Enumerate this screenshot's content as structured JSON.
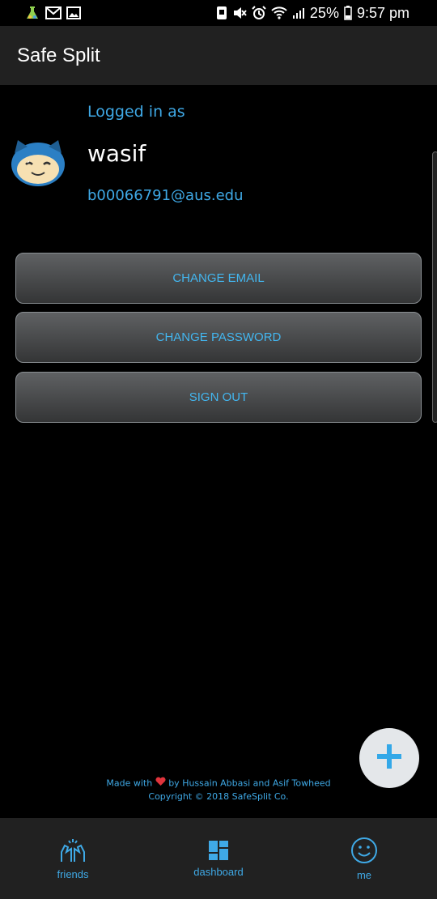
{
  "status_bar": {
    "battery": "25%",
    "time": "9:57 pm",
    "icons_left": [
      "app-notification-icon",
      "gmail-icon",
      "gallery-icon"
    ],
    "icons_right": [
      "nfc-icon",
      "mute-icon",
      "alarm-icon",
      "wifi-icon",
      "signal-icon",
      "battery-icon"
    ]
  },
  "app_bar": {
    "title": "Safe Split"
  },
  "profile": {
    "logged_in_label": "Logged in as",
    "username": "wasif",
    "email": "b00066791@aus.edu"
  },
  "actions": {
    "change_email": "CHANGE EMAIL",
    "change_password": "CHANGE PASSWORD",
    "sign_out": "SIGN OUT"
  },
  "footer": {
    "made_with": "Made with",
    "by": "by Hussain Abbasi and Asif Towheed",
    "copyright": "Copyright © 2018 SafeSplit Co."
  },
  "bottom_nav": {
    "items": [
      {
        "label": "friends",
        "icon": "high-five-icon"
      },
      {
        "label": "dashboard",
        "icon": "dashboard-icon"
      },
      {
        "label": "me",
        "icon": "smiley-icon"
      }
    ]
  },
  "colors": {
    "accent": "#3fa9e6",
    "appbar": "#212121",
    "background": "#000000",
    "fab": "#e4e7ea",
    "heart": "#e0343c"
  }
}
